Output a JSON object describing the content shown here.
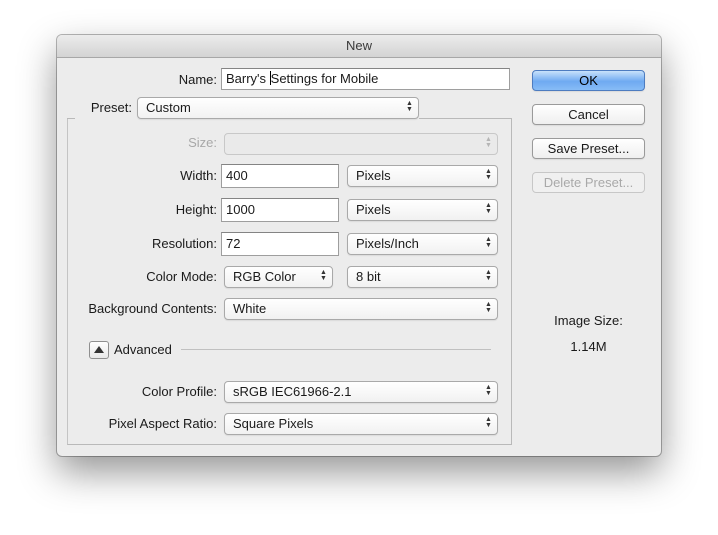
{
  "window": {
    "title": "New"
  },
  "name": {
    "label": "Name:",
    "value_before": "Barry's ",
    "value_after": "Settings for Mobile"
  },
  "preset": {
    "label": "Preset:",
    "value": "Custom"
  },
  "size": {
    "label": "Size:",
    "value": ""
  },
  "width": {
    "label": "Width:",
    "value": "400",
    "unit": "Pixels"
  },
  "height": {
    "label": "Height:",
    "value": "1000",
    "unit": "Pixels"
  },
  "resolution": {
    "label": "Resolution:",
    "value": "72",
    "unit": "Pixels/Inch"
  },
  "color_mode": {
    "label": "Color Mode:",
    "value": "RGB Color",
    "depth": "8 bit"
  },
  "background": {
    "label": "Background Contents:",
    "value": "White"
  },
  "advanced": {
    "label": "Advanced"
  },
  "color_profile": {
    "label": "Color Profile:",
    "value": "sRGB IEC61966-2.1"
  },
  "pixel_aspect": {
    "label": "Pixel Aspect Ratio:",
    "value": "Square Pixels"
  },
  "buttons": {
    "ok": "OK",
    "cancel": "Cancel",
    "save_preset": "Save Preset...",
    "delete_preset": "Delete Preset..."
  },
  "image_size": {
    "label": "Image Size:",
    "value": "1.14M"
  },
  "colors": {
    "primary_button": "#6faaf1",
    "dialog_bg": "#ececec"
  },
  "icons": {
    "popup_arrows": "updown-chevrons-icon",
    "disclosure": "triangle-up-icon"
  }
}
